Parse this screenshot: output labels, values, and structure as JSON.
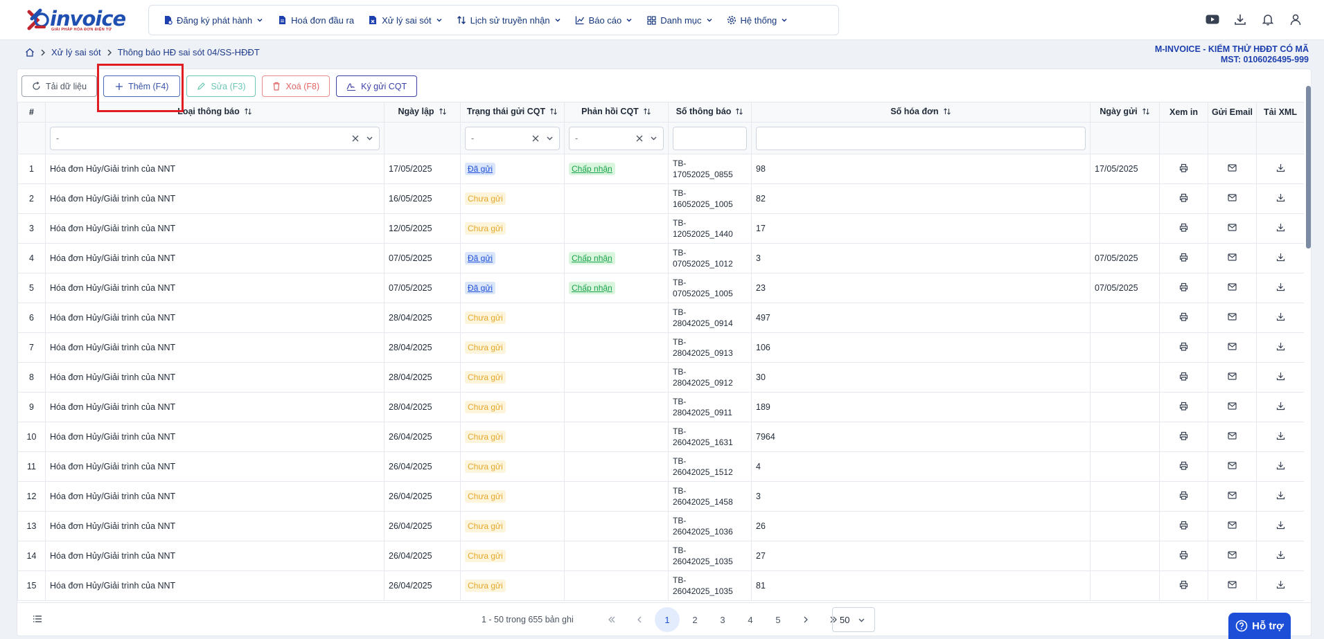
{
  "logo": {
    "text": "invoice",
    "tagline": "GIẢI PHÁP HÓA ĐƠN ĐIỆN TỬ"
  },
  "nav": [
    {
      "label": "Đăng ký phát hành",
      "icon": "file-register-icon",
      "dropdown": true
    },
    {
      "label": "Hoá đơn đầu ra",
      "icon": "file-icon",
      "dropdown": false
    },
    {
      "label": "Xử lý sai sót",
      "icon": "error-process-icon",
      "dropdown": true
    },
    {
      "label": "Lịch sử truyền nhận",
      "icon": "transfer-icon",
      "dropdown": true
    },
    {
      "label": "Báo cáo",
      "icon": "chart-icon",
      "dropdown": true
    },
    {
      "label": "Danh mục",
      "icon": "grid-icon",
      "dropdown": true
    },
    {
      "label": "Hệ thống",
      "icon": "gear-icon",
      "dropdown": true
    }
  ],
  "breadcrumb": [
    "Xử lý sai sót",
    "Thông báo HĐ sai sót 04/SS-HĐĐT"
  ],
  "company": {
    "name": "M-INVOICE - KIỂM THỬ HĐĐT CÓ MÃ",
    "tax_id": "MST: 0106026495-999"
  },
  "toolbar": {
    "reload": "Tải dữ liệu",
    "add": "Thêm (F4)",
    "edit": "Sửa (F3)",
    "delete": "Xoá (F8)",
    "sign": "Ký gửi CQT"
  },
  "columns": {
    "idx": "#",
    "type": "Loại thông báo",
    "date": "Ngày lập",
    "status": "Trạng thái gửi CQT",
    "response": "Phản hồi CQT",
    "notice_no": "Số thông báo",
    "invoice_no": "Số hóa đơn",
    "sent_date": "Ngày gửi",
    "print": "Xem in",
    "email": "Gửi Email",
    "xml": "Tải XML"
  },
  "filters": {
    "type": "-",
    "status": "-",
    "response": "-"
  },
  "status_colors": {
    "sent": "#1d4ed8",
    "unsent": "#e5a82a",
    "accepted": "#16a34a"
  },
  "rows": [
    {
      "idx": "1",
      "type": "Hóa đơn Hủy/Giải trình của NNT",
      "date": "17/05/2025",
      "status": "Đã gửi",
      "status_kind": "sent",
      "response": "Chấp nhận",
      "notice_a": "TB-",
      "notice_b": "17052025_0855",
      "invoice": "98",
      "sent": "17/05/2025"
    },
    {
      "idx": "2",
      "type": "Hóa đơn Hủy/Giải trình của NNT",
      "date": "16/05/2025",
      "status": "Chưa gửi",
      "status_kind": "unsent",
      "response": "",
      "notice_a": "TB-",
      "notice_b": "16052025_1005",
      "invoice": "82",
      "sent": ""
    },
    {
      "idx": "3",
      "type": "Hóa đơn Hủy/Giải trình của NNT",
      "date": "12/05/2025",
      "status": "Chưa gửi",
      "status_kind": "unsent",
      "response": "",
      "notice_a": "TB-",
      "notice_b": "12052025_1440",
      "invoice": "17",
      "sent": ""
    },
    {
      "idx": "4",
      "type": "Hóa đơn Hủy/Giải trình của NNT",
      "date": "07/05/2025",
      "status": "Đã gửi",
      "status_kind": "sent",
      "response": "Chấp nhận",
      "notice_a": "TB-",
      "notice_b": "07052025_1012",
      "invoice": "3",
      "sent": "07/05/2025"
    },
    {
      "idx": "5",
      "type": "Hóa đơn Hủy/Giải trình của NNT",
      "date": "07/05/2025",
      "status": "Đã gửi",
      "status_kind": "sent",
      "response": "Chấp nhận",
      "notice_a": "TB-",
      "notice_b": "07052025_1005",
      "invoice": "23",
      "sent": "07/05/2025"
    },
    {
      "idx": "6",
      "type": "Hóa đơn Hủy/Giải trình của NNT",
      "date": "28/04/2025",
      "status": "Chưa gửi",
      "status_kind": "unsent",
      "response": "",
      "notice_a": "TB-",
      "notice_b": "28042025_0914",
      "invoice": "497",
      "sent": ""
    },
    {
      "idx": "7",
      "type": "Hóa đơn Hủy/Giải trình của NNT",
      "date": "28/04/2025",
      "status": "Chưa gửi",
      "status_kind": "unsent",
      "response": "",
      "notice_a": "TB-",
      "notice_b": "28042025_0913",
      "invoice": "106",
      "sent": ""
    },
    {
      "idx": "8",
      "type": "Hóa đơn Hủy/Giải trình của NNT",
      "date": "28/04/2025",
      "status": "Chưa gửi",
      "status_kind": "unsent",
      "response": "",
      "notice_a": "TB-",
      "notice_b": "28042025_0912",
      "invoice": "30",
      "sent": ""
    },
    {
      "idx": "9",
      "type": "Hóa đơn Hủy/Giải trình của NNT",
      "date": "28/04/2025",
      "status": "Chưa gửi",
      "status_kind": "unsent",
      "response": "",
      "notice_a": "TB-",
      "notice_b": "28042025_0911",
      "invoice": "189",
      "sent": ""
    },
    {
      "idx": "10",
      "type": "Hóa đơn Hủy/Giải trình của NNT",
      "date": "26/04/2025",
      "status": "Chưa gửi",
      "status_kind": "unsent",
      "response": "",
      "notice_a": "TB-",
      "notice_b": "26042025_1631",
      "invoice": "7964",
      "sent": ""
    },
    {
      "idx": "11",
      "type": "Hóa đơn Hủy/Giải trình của NNT",
      "date": "26/04/2025",
      "status": "Chưa gửi",
      "status_kind": "unsent",
      "response": "",
      "notice_a": "TB-",
      "notice_b": "26042025_1512",
      "invoice": "4",
      "sent": ""
    },
    {
      "idx": "12",
      "type": "Hóa đơn Hủy/Giải trình của NNT",
      "date": "26/04/2025",
      "status": "Chưa gửi",
      "status_kind": "unsent",
      "response": "",
      "notice_a": "TB-",
      "notice_b": "26042025_1458",
      "invoice": "3",
      "sent": ""
    },
    {
      "idx": "13",
      "type": "Hóa đơn Hủy/Giải trình của NNT",
      "date": "26/04/2025",
      "status": "Chưa gửi",
      "status_kind": "unsent",
      "response": "",
      "notice_a": "TB-",
      "notice_b": "26042025_1036",
      "invoice": "26",
      "sent": ""
    },
    {
      "idx": "14",
      "type": "Hóa đơn Hủy/Giải trình của NNT",
      "date": "26/04/2025",
      "status": "Chưa gửi",
      "status_kind": "unsent",
      "response": "",
      "notice_a": "TB-",
      "notice_b": "26042025_1035",
      "invoice": "27",
      "sent": ""
    },
    {
      "idx": "15",
      "type": "Hóa đơn Hủy/Giải trình của NNT",
      "date": "26/04/2025",
      "status": "Chưa gửi",
      "status_kind": "unsent",
      "response": "",
      "notice_a": "TB-",
      "notice_b": "26042025_1035",
      "invoice": "81",
      "sent": ""
    }
  ],
  "pagination": {
    "info": "1 - 50 trong 655 bản ghi",
    "pages": [
      "1",
      "2",
      "3",
      "4",
      "5"
    ],
    "current": "1",
    "page_size": "50"
  },
  "help": {
    "label": "Hỗ trợ"
  }
}
